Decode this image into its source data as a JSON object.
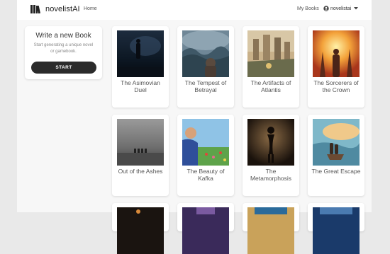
{
  "navbar": {
    "brand": "novelistAI",
    "home": "Home",
    "my_books": "My Books",
    "user": "novelistai",
    "icons": [
      "books-logo-icon",
      "user-circle-icon",
      "caret-down-icon"
    ]
  },
  "create": {
    "title": "Write a new Book",
    "subtitle": "Start generating a unique novel or gamebook.",
    "button": "START"
  },
  "books": [
    {
      "title": "The Asimovian Duel"
    },
    {
      "title": "The Tempest of Betrayal"
    },
    {
      "title": "The Artifacts of Atlantis"
    },
    {
      "title": "The Sorcerers of the Crown"
    },
    {
      "title": "Out of the Ashes"
    },
    {
      "title": "The Beauty of Kafka"
    },
    {
      "title": "The Metamorphosis"
    },
    {
      "title": "The Great Escape"
    }
  ]
}
